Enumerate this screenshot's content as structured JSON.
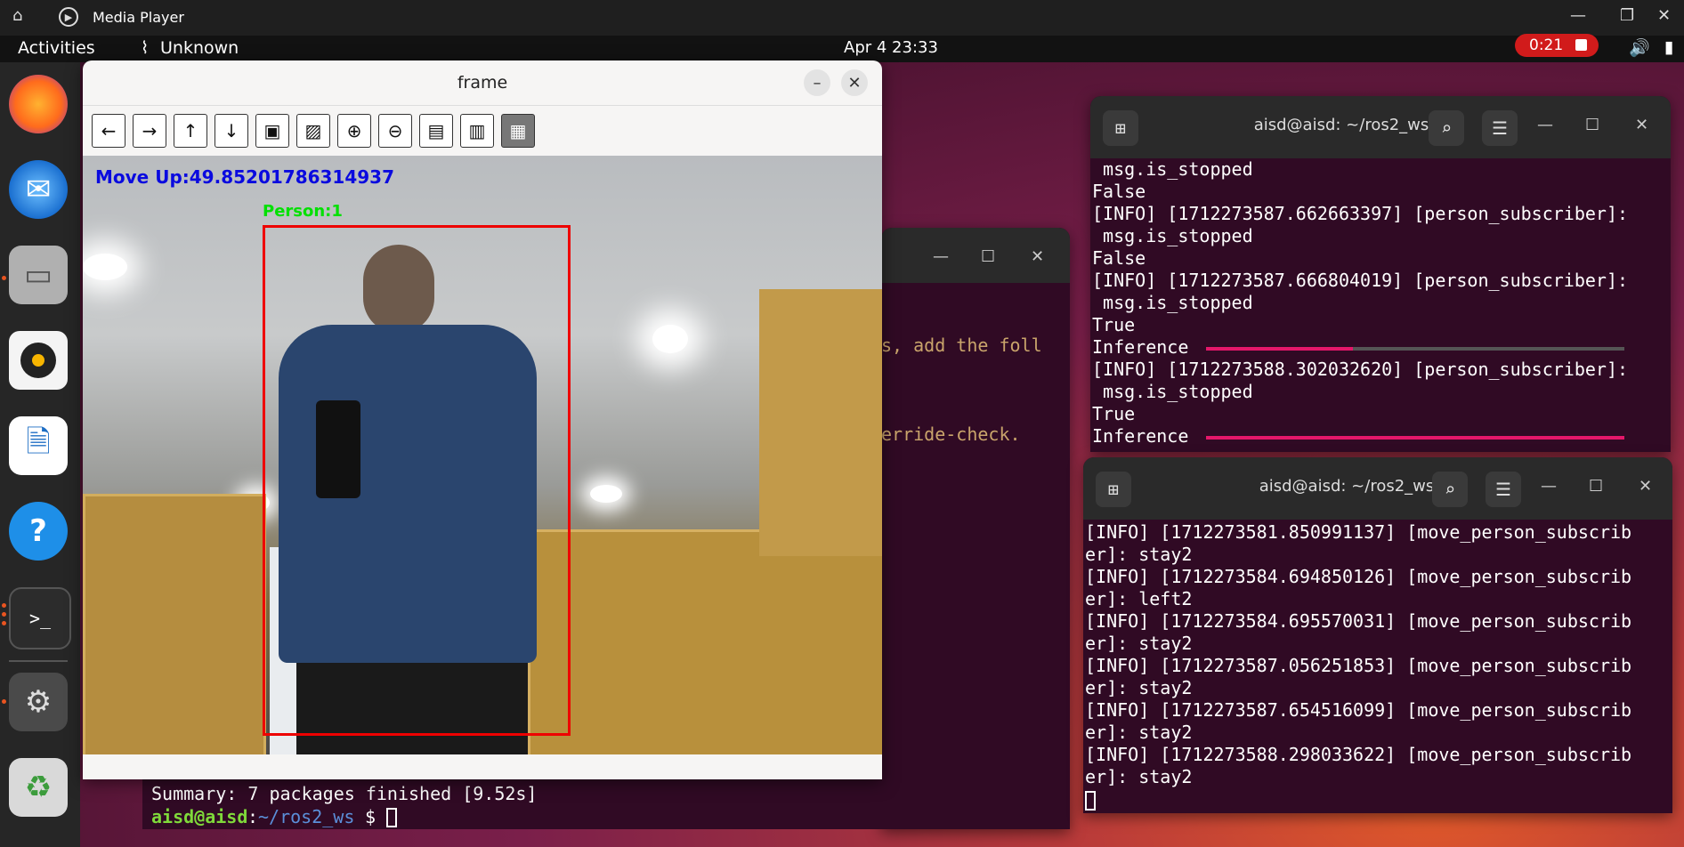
{
  "host": {
    "title": "Media Player",
    "home_icon": "home-icon",
    "app_icon": "play-icon"
  },
  "topbar": {
    "activities": "Activities",
    "network": "Unknown",
    "clock": "Apr 4  23:33",
    "record_time": "0:21"
  },
  "frame": {
    "title": "frame",
    "overlay_move": "Move Up:49.85201786314937",
    "overlay_person": "Person:1",
    "toolbar": [
      "arrow-left-icon",
      "arrow-right-icon",
      "arrow-up-icon",
      "arrow-down-icon",
      "image-icon",
      "image-edit-icon",
      "zoom-in-icon",
      "zoom-out-icon",
      "save-icon",
      "clipboard-icon",
      "brush-icon"
    ]
  },
  "bg_terminal": {
    "text1": "s, add the foll",
    "text2": "erride-check.",
    "summary": "Summary: 7 packages finished [9.52s]",
    "prompt_user": "aisd@aisd",
    "prompt_sep": ":",
    "prompt_path": "~/ros2_ws",
    "prompt_dollar": "$"
  },
  "term1": {
    "title": "aisd@aisd: ~/ros2_ws",
    "lines": [
      " msg.is_stopped",
      "False",
      "[INFO] [1712273587.662663397] [person_subscriber]:",
      " msg.is_stopped",
      "False",
      "[INFO] [1712273587.666804019] [person_subscriber]:",
      " msg.is_stopped",
      "True",
      "Inference",
      "[INFO] [1712273588.302032620] [person_subscriber]:",
      " msg.is_stopped",
      "True",
      "Inference"
    ],
    "progress": [
      0.35,
      1.0
    ]
  },
  "term2": {
    "title": "aisd@aisd: ~/ros2_ws",
    "lines": [
      "[INFO] [1712273581.850991137] [move_person_subscrib",
      "er]: stay2",
      "[INFO] [1712273584.694850126] [move_person_subscrib",
      "er]: left2",
      "[INFO] [1712273584.695570031] [move_person_subscrib",
      "er]: stay2",
      "[INFO] [1712273587.056251853] [move_person_subscrib",
      "er]: stay2",
      "[INFO] [1712273587.654516099] [move_person_subscrib",
      "er]: stay2",
      "[INFO] [1712273588.298033622] [move_person_subscrib",
      "er]: stay2"
    ]
  }
}
